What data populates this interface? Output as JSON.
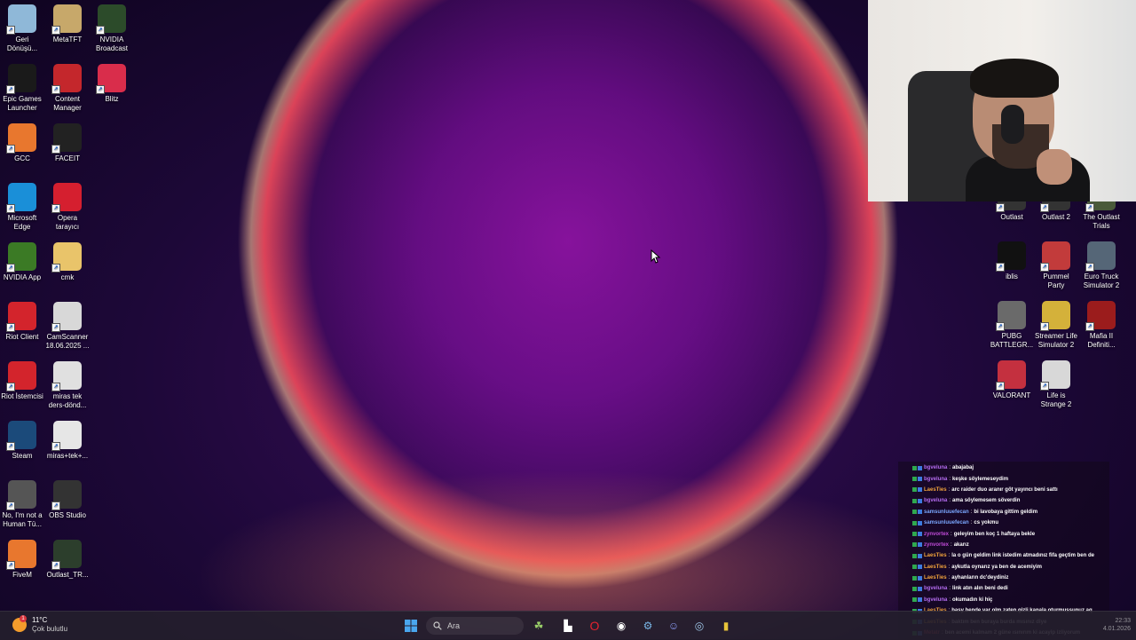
{
  "desktop_left": [
    {
      "label": "Geri\nDönüşü...",
      "icon": "recycle-bin-icon",
      "color": "#8fb8d8"
    },
    {
      "label": "MetaTFT",
      "icon": "metatft-icon",
      "color": "#c7a86a"
    },
    {
      "label": "NVIDIA\nBroadcast",
      "icon": "nvidia-broadcast-icon",
      "color": "#2c4b2a"
    },
    {
      "label": "Epic Games\nLauncher",
      "icon": "epic-games-icon",
      "color": "#1a1a1a"
    },
    {
      "label": "Content\nManager",
      "icon": "content-manager-icon",
      "color": "#c4272c"
    },
    {
      "label": "Blitz",
      "icon": "blitz-icon",
      "color": "#d92d4b"
    },
    {
      "label": "GCC",
      "icon": "gcc-icon",
      "color": "#e8772e"
    },
    {
      "label": "FACEIT",
      "icon": "faceit-icon",
      "color": "#222"
    },
    {
      "label": "Microsoft\nEdge",
      "icon": "edge-icon",
      "color": "#1a8fd8"
    },
    {
      "label": "Opera\ntarayıcı",
      "icon": "opera-icon",
      "color": "#d51f2f"
    },
    {
      "label": "NVIDIA App",
      "icon": "nvidia-app-icon",
      "color": "#3b7a25"
    },
    {
      "label": "cmk",
      "icon": "folder-icon",
      "color": "#e9c46a"
    },
    {
      "label": "Riot Client",
      "icon": "riot-client-icon",
      "color": "#d3242c"
    },
    {
      "label": "CamScanner\n18.06.2025 ...",
      "icon": "document-icon",
      "color": "#d8d8d8"
    },
    {
      "label": "Riot İstemcisi",
      "icon": "riot-istemcisi-icon",
      "color": "#d3242c"
    },
    {
      "label": "miras tek\nders-dönd...",
      "icon": "document-icon",
      "color": "#e0e0e0"
    },
    {
      "label": "Steam",
      "icon": "steam-icon",
      "color": "#1b4a7a"
    },
    {
      "label": "miras+tek+...",
      "icon": "document-icon",
      "color": "#e6e6e6"
    },
    {
      "label": "No, I'm not a\nHuman Tü...",
      "icon": "game-icon",
      "color": "#555"
    },
    {
      "label": "OBS Studio",
      "icon": "obs-icon",
      "color": "#333"
    },
    {
      "label": "FiveM",
      "icon": "fivem-icon",
      "color": "#e8772e"
    },
    {
      "label": "Outlast_TR...",
      "icon": "outlast-tr-icon",
      "color": "#2c3e2c"
    }
  ],
  "desktop_right": [
    {
      "label": "Outlast",
      "icon": "outlast-icon",
      "color": "#333"
    },
    {
      "label": "Outlast 2",
      "icon": "outlast2-icon",
      "color": "#333"
    },
    {
      "label": "The Outlast\nTrials",
      "icon": "outlast-trials-icon",
      "color": "#4a5a3a"
    },
    {
      "label": "iblis",
      "icon": "iblis-icon",
      "color": "#111"
    },
    {
      "label": "Pummel\nParty",
      "icon": "pummel-party-icon",
      "color": "#c23b3b"
    },
    {
      "label": "Euro Truck\nSimulator 2",
      "icon": "euro-truck-icon",
      "color": "#567"
    },
    {
      "label": "PUBG\nBATTLEGR...",
      "icon": "pubg-icon",
      "color": "#6a6a6a"
    },
    {
      "label": "Streamer Life\nSimulator 2",
      "icon": "streamer-life-icon",
      "color": "#d4b13a"
    },
    {
      "label": "Mafia II\nDefiniti...",
      "icon": "mafia-icon",
      "color": "#9b1c1c"
    },
    {
      "label": "VALORANT",
      "icon": "valorant-icon",
      "color": "#c4303f"
    },
    {
      "label": "Life is\nStrange 2",
      "icon": "life-is-strange-icon",
      "color": "#d8d8d8"
    }
  ],
  "chat": [
    {
      "user": "bgveluna",
      "color": "#b46cf0",
      "msg": "abajabaj"
    },
    {
      "user": "bgveluna",
      "color": "#b46cf0",
      "msg": "keşke söylemeseydim"
    },
    {
      "user": "LaesTies",
      "color": "#f0a33c",
      "msg": "arc raider duo aranır göt yayıncı beni sattı"
    },
    {
      "user": "bgveluna",
      "color": "#b46cf0",
      "msg": "ama söylemesem söverdin"
    },
    {
      "user": "samsunluuefecan",
      "color": "#7aa7ff",
      "msg": "bi lavobaya gittim geldim"
    },
    {
      "user": "samsunluuefecan",
      "color": "#7aa7ff",
      "msg": "cs yokmu"
    },
    {
      "user": "zynvortex",
      "color": "#c04bd8",
      "msg": "geleyim ben koç 1 haftaya bekle"
    },
    {
      "user": "zynvortex",
      "color": "#c04bd8",
      "msg": "akarız"
    },
    {
      "user": "LaesTies",
      "color": "#f0a33c",
      "msg": "la o gün geldim link istedim atmadınız fifa geçtim ben de"
    },
    {
      "user": "LaesTies",
      "color": "#f0a33c",
      "msg": "aykutla oynarız ya ben de acemiyim"
    },
    {
      "user": "LaesTies",
      "color": "#f0a33c",
      "msg": "ayhanların dc'deydiniz"
    },
    {
      "user": "bgveluna",
      "color": "#b46cf0",
      "msg": "link atın alın beni dedi"
    },
    {
      "user": "bgveluna",
      "color": "#b46cf0",
      "msg": "okumadın ki hiç"
    },
    {
      "user": "LaesTies",
      "color": "#f0a33c",
      "msg": "basy bende var olm zaten gizli kanala oturmuşsunuz aq"
    },
    {
      "user": "LaesTies",
      "color": "#f0a33c",
      "msg": "baktım ben buraya burda mısınız diye"
    },
    {
      "user": "Metatr",
      "color": "#e0414f",
      "msg": "ben acemi kalmam 2 güne ısınırım ki acayip izliyorum"
    }
  ],
  "taskbar": {
    "temperature": "11°C",
    "condition": "Çok bulutlu",
    "search_placeholder": "Ara",
    "notif": "1",
    "time": "22:33",
    "date": "4.01.2026"
  }
}
